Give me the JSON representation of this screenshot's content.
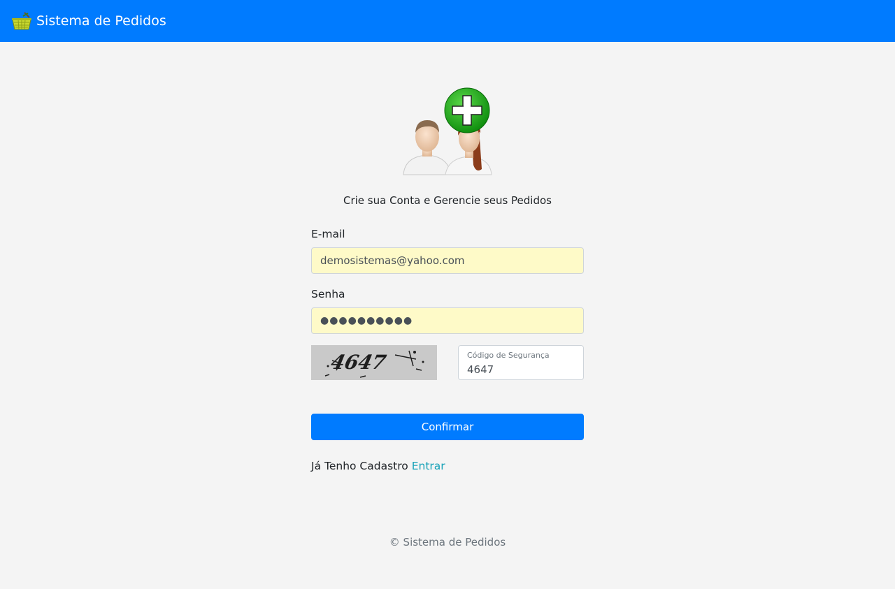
{
  "navbar": {
    "brand_title": "Sistema de Pedidos",
    "brand_icon": "basket-icon",
    "color": "#007bff"
  },
  "main": {
    "hero_icon": "add-users-icon",
    "subtitle": "Crie sua Conta e Gerencie seus Pedidos",
    "email": {
      "label": "E-mail",
      "value": "demosistemas@yahoo.com"
    },
    "password": {
      "label": "Senha",
      "value": "●●●●●●●●●●"
    },
    "captcha": {
      "image_text": "4647",
      "field_label": "Código de Segurança",
      "value": "4647"
    },
    "confirm_label": "Confirmar",
    "login_prompt": "Já Tenho Cadastro",
    "login_link": "Entrar"
  },
  "footer": {
    "text": "© Sistema de Pedidos"
  }
}
